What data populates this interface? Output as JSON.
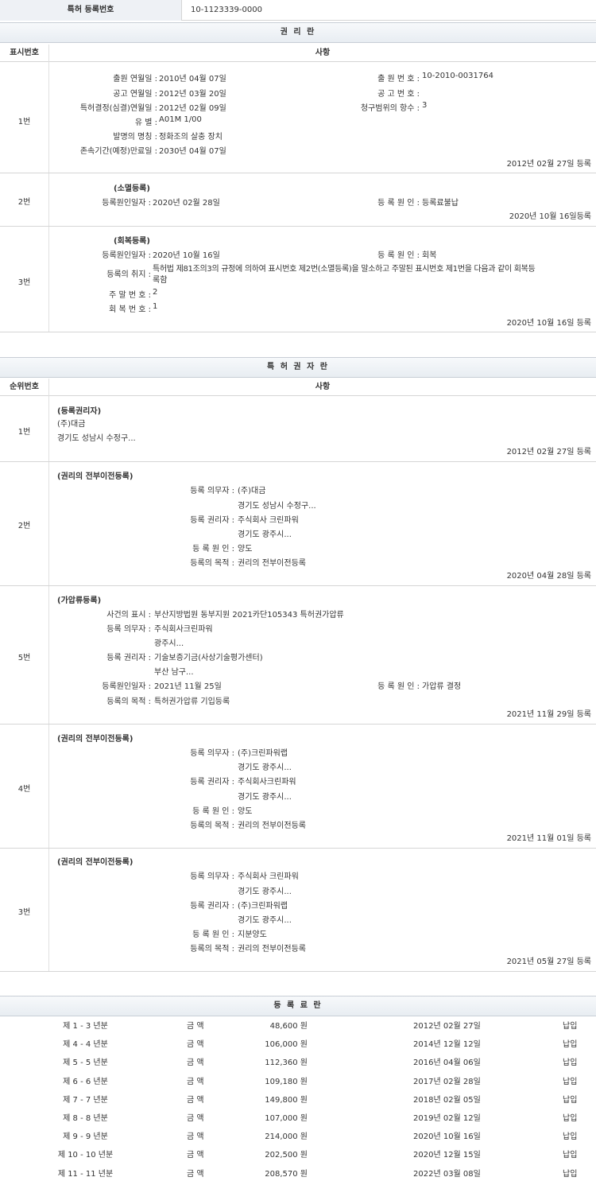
{
  "header": {
    "label": "특허 등록번호",
    "value": "10-1123339-0000"
  },
  "rights": {
    "title": "권 리 란",
    "col1": "표시번호",
    "col2": "사항",
    "r1": {
      "num": "1번",
      "app_date_label": "출원 연월일 :",
      "app_date": "2010년 04월 07일",
      "app_no_label": "출 원 번 호 :",
      "app_no": "10-2010-0031764",
      "pub_date_label": "공고 연월일 :",
      "pub_date": "2012년 03월 20일",
      "pub_no_label": "공 고 번 호 :",
      "pub_no": "",
      "decision_label": "특허결정(심결)연월일 :",
      "decision": "2012년 02월 09일",
      "claims_label": "청구범위의 항수 :",
      "claims": "3",
      "type_label": "유 별 :",
      "type": "A01M 1/00",
      "name_label": "발명의 명칭 :",
      "name": "정화조의 살충 장치",
      "expire_label": "존속기간(예정)만료일 :",
      "expire": "2030년 04월 07일",
      "reg": "2012년 02월 27일 등록"
    },
    "r2": {
      "num": "2번",
      "kind": "(소멸등록)",
      "cause_date_label": "등록원인일자 :",
      "cause_date": "2020년 02월 28일",
      "cause_label": "등 록 원 인 :",
      "cause": "등록료불납",
      "reg": "2020년 10월 16일등록"
    },
    "r3": {
      "num": "3번",
      "kind": "(회복등록)",
      "cause_date_label": "등록원인일자 :",
      "cause_date": "2020년 10월 16일",
      "cause_label": "등 록 원 인 :",
      "cause": "회복",
      "purpose_label": "등록의 취지 :",
      "purpose1": "특허법 제81조의3의 규정에 의하여 표시번호 제2번(소멸등록)을 말소하고 주말된 표시번호 제1번을 다음과 같이 회복등",
      "purpose2": "록함",
      "end_no_label": "주 말 번 호 :",
      "end_no": "2",
      "rec_no_label": "회 복 번 호 :",
      "rec_no": "1",
      "reg": "2020년 10월 16일 등록"
    }
  },
  "holders": {
    "title": "특 허 권 자 란",
    "col1": "순위번호",
    "col2": "사항",
    "h1": {
      "num": "1번",
      "kind": "(등록권리자)",
      "name": "(주)대금",
      "addr": "경기도 성남시 수정구...",
      "reg": "2012년 02월 27일 등록"
    },
    "h2": {
      "num": "2번",
      "kind": "(권리의 전부이전등록)",
      "obligor_label": "등록 의무자 :",
      "obligor": "(주)대금",
      "obligor_addr": "경기도 성남시 수정구...",
      "holder_label": "등록 권리자 :",
      "holder": "주식회사 크린파워",
      "holder_addr": "경기도 광주시...",
      "cause_label": "등 록 원 인 :",
      "cause": "양도",
      "purpose_label": "등록의 목적 :",
      "purpose": "권리의 전부이전등록",
      "reg": "2020년 04월 28일 등록"
    },
    "h5": {
      "num": "5번",
      "kind": "(가압류등록)",
      "case_label": "사건의 표시 :",
      "case": "부산지방법원 동부지원 2021카단105343 특허권가압류",
      "obligor_label": "등록 의무자 :",
      "obligor": "주식회사크린파워",
      "obligor_addr": "광주시...",
      "holder_label": "등록 권리자 :",
      "holder": "기술보증기금(사상기술평가센터)",
      "holder_addr": "부산 남구...",
      "cause_date_label": "등록원인일자 :",
      "cause_date": "2021년 11월 25일",
      "cause_label": "등 록 원 인 :",
      "cause": "가압류 결정",
      "purpose_label": "등록의 목적 :",
      "purpose": "특허권가압류 기입등록",
      "reg": "2021년 11월 29일 등록"
    },
    "h4": {
      "num": "4번",
      "kind": "(권리의 전부이전등록)",
      "obligor_label": "등록 의무자 :",
      "obligor": "(주)크린파워랩",
      "obligor_addr": "경기도 광주시...",
      "holder_label": "등록 권리자 :",
      "holder": "주식회사크린파워",
      "holder_addr": "경기도 광주시...",
      "cause_label": "등 록 원 인 :",
      "cause": "양도",
      "purpose_label": "등록의 목적 :",
      "purpose": "권리의 전부이전등록",
      "reg": "2021년 11월 01일 등록"
    },
    "h3": {
      "num": "3번",
      "kind": "(권리의 전부이전등록)",
      "obligor_label": "등록 의무자 :",
      "obligor": "주식회사 크린파워",
      "obligor_addr": "경기도 광주시...",
      "holder_label": "등록 권리자 :",
      "holder": "(주)크린파워랩",
      "holder_addr": "경기도 광주시...",
      "cause_label": "등 록 원 인 :",
      "cause": "지분양도",
      "purpose_label": "등록의 목적 :",
      "purpose": "권리의 전부이전등록",
      "reg": "2021년 05월 27일 등록"
    }
  },
  "fees": {
    "title": "등 록 료 란",
    "amount_label": "금 액",
    "rows": [
      {
        "period": "제 1 - 3 년분",
        "amount": "48,600 원",
        "date": "2012년 02월 27일",
        "status": "납입"
      },
      {
        "period": "제 4 - 4 년분",
        "amount": "106,000 원",
        "date": "2014년 12월 12일",
        "status": "납입"
      },
      {
        "period": "제 5 - 5 년분",
        "amount": "112,360 원",
        "date": "2016년 04월 06일",
        "status": "납입"
      },
      {
        "period": "제 6 - 6 년분",
        "amount": "109,180 원",
        "date": "2017년 02월 28일",
        "status": "납입"
      },
      {
        "period": "제 7 - 7 년분",
        "amount": "149,800 원",
        "date": "2018년 02월 05일",
        "status": "납입"
      },
      {
        "period": "제 8 - 8 년분",
        "amount": "107,000 원",
        "date": "2019년 02월 12일",
        "status": "납입"
      },
      {
        "period": "제 9 - 9 년분",
        "amount": "214,000 원",
        "date": "2020년 10월 16일",
        "status": "납입"
      },
      {
        "period": "제 10 - 10 년분",
        "amount": "202,500 원",
        "date": "2020년 12월 15일",
        "status": "납입"
      },
      {
        "period": "제 11 - 11 년분",
        "amount": "208,570 원",
        "date": "2022년 03월 08일",
        "status": "납입"
      }
    ]
  }
}
